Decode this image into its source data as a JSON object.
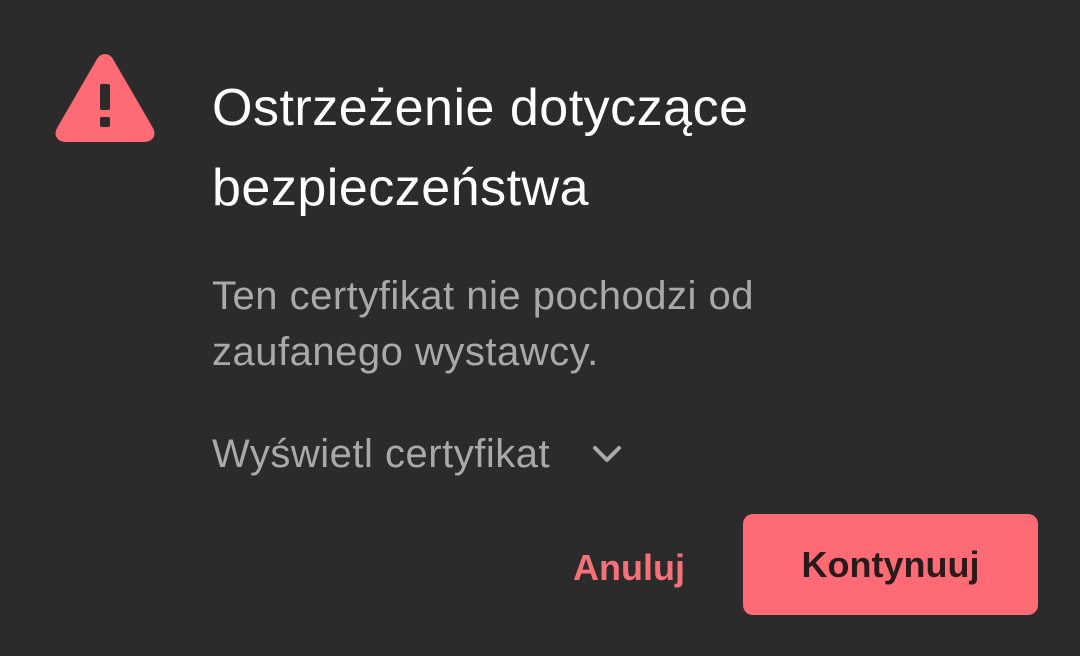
{
  "dialog": {
    "icon": "warning-triangle-icon",
    "title_line1": "Ostrzeżenie dotyczące",
    "title_line2": "bezpieczeństwa",
    "message_line1": "Ten certyfikat nie pochodzi od",
    "message_line2": "zaufanego wystawcy.",
    "expander_label": "Wyświetl certyfikat",
    "expander_icon": "chevron-down-icon",
    "cancel_label": "Anuluj",
    "continue_label": "Kontynuuj"
  },
  "colors": {
    "background": "#2b2b2b",
    "accent": "#ff6b74",
    "title_text": "#ffffff",
    "secondary_text": "#a9a9a9"
  }
}
